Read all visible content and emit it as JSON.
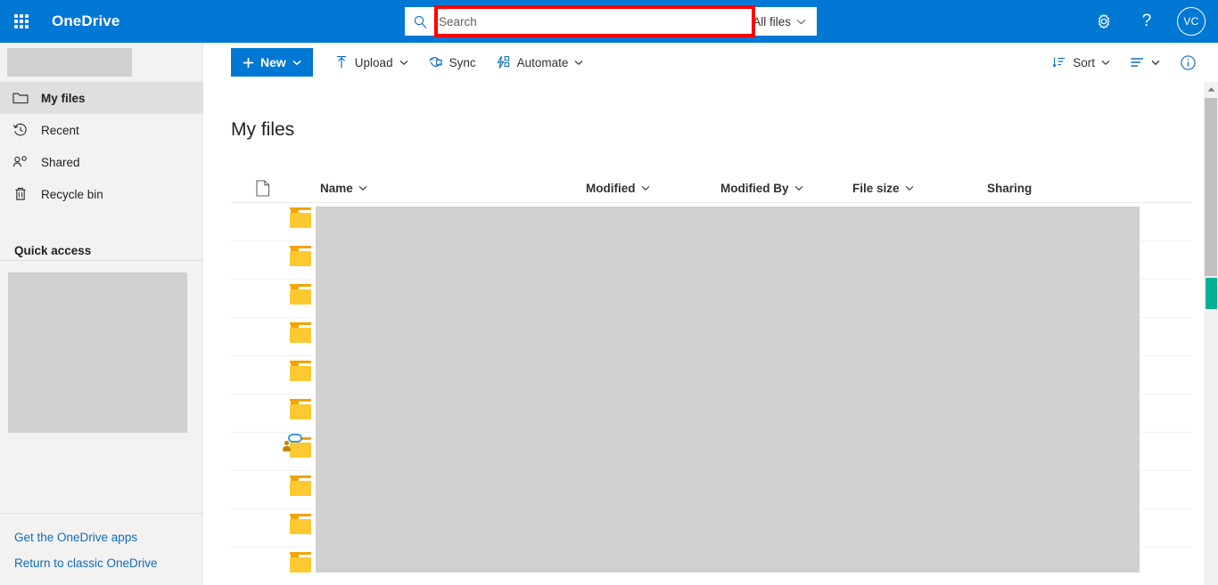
{
  "suite": {
    "waffle_label": "app-launcher",
    "brand": "OneDrive",
    "settings_label": "Settings",
    "help_label": "Help",
    "avatar_initials": "VC"
  },
  "search": {
    "placeholder": "Search",
    "value": "",
    "scope_label": "All files",
    "highlight_color": "#ff0000"
  },
  "sidebar": {
    "items": [
      {
        "label": "My files",
        "icon": "folder-icon",
        "selected": true
      },
      {
        "label": "Recent",
        "icon": "clock-icon",
        "selected": false
      },
      {
        "label": "Shared",
        "icon": "people-icon",
        "selected": false
      },
      {
        "label": "Recycle bin",
        "icon": "trash-icon",
        "selected": false
      }
    ],
    "quick_access_label": "Quick access",
    "footer_links": [
      {
        "label": "Get the OneDrive apps"
      },
      {
        "label": "Return to classic OneDrive"
      }
    ]
  },
  "toolbar": {
    "new_label": "New",
    "upload_label": "Upload",
    "sync_label": "Sync",
    "automate_label": "Automate",
    "sort_label": "Sort",
    "view_label": "",
    "info_label": ""
  },
  "main": {
    "title": "My files",
    "columns": [
      {
        "label": "Name",
        "sortable": true
      },
      {
        "label": "Modified",
        "sortable": true
      },
      {
        "label": "Modified By",
        "sortable": true
      },
      {
        "label": "File size",
        "sortable": true
      },
      {
        "label": "Sharing",
        "sortable": false
      }
    ],
    "rows": [
      {
        "icon": "folder-icon",
        "shared": false
      },
      {
        "icon": "folder-icon",
        "shared": false
      },
      {
        "icon": "folder-icon",
        "shared": false
      },
      {
        "icon": "folder-icon",
        "shared": false
      },
      {
        "icon": "folder-icon",
        "shared": false
      },
      {
        "icon": "folder-icon",
        "shared": false
      },
      {
        "icon": "shared-folder-icon",
        "shared": true
      },
      {
        "icon": "folder-icon",
        "shared": false
      },
      {
        "icon": "folder-icon",
        "shared": false
      },
      {
        "icon": "folder-icon",
        "shared": false
      }
    ]
  },
  "colors": {
    "brand_blue": "#0078d4",
    "sidebar_bg": "#f3f2f1",
    "redaction_gray": "#d2d0ce",
    "scroll_marker_green": "#00b294"
  }
}
